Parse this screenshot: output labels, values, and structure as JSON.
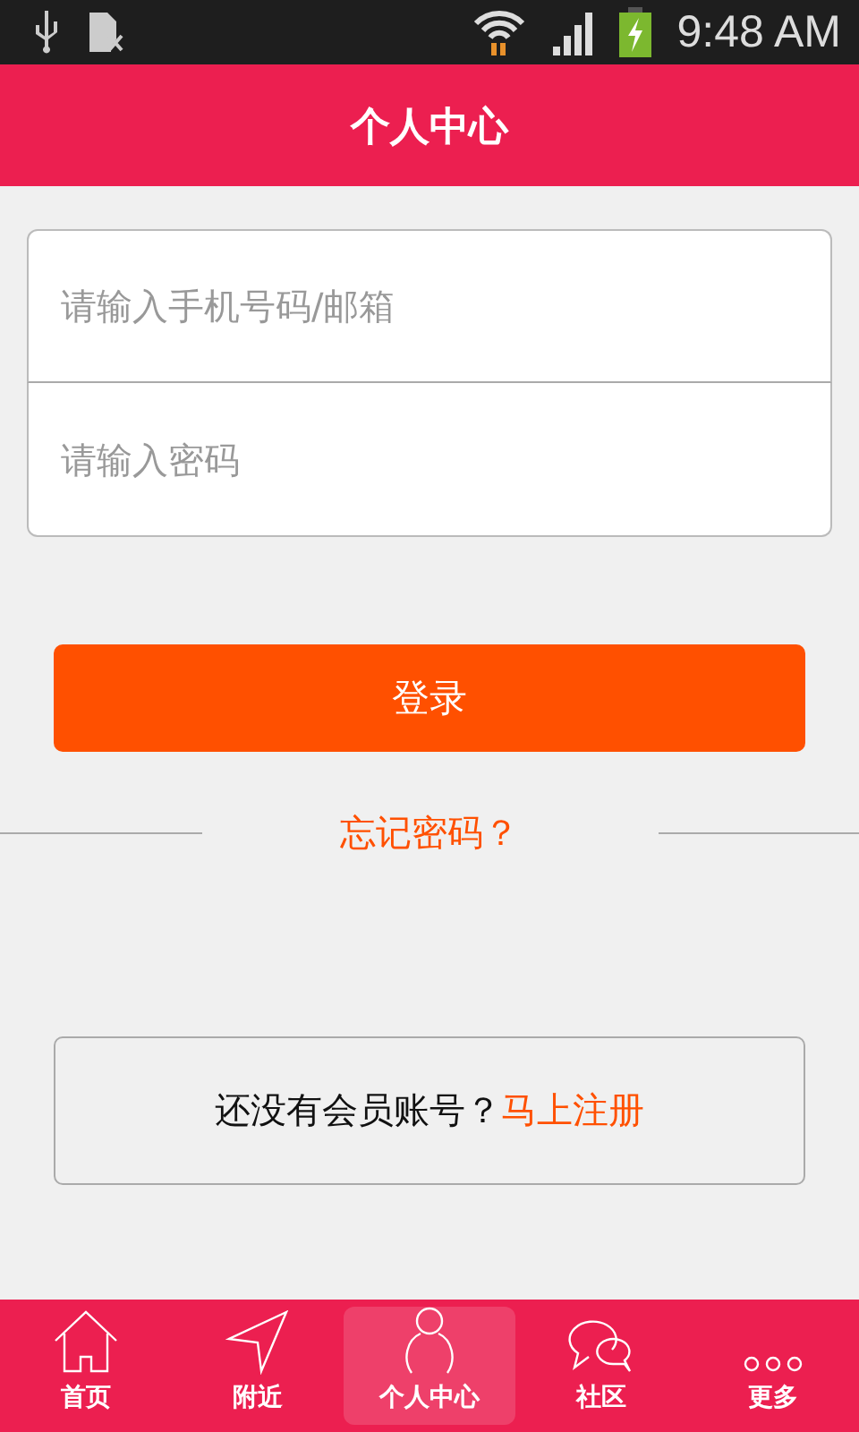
{
  "status_bar": {
    "time": "9:48 AM"
  },
  "header": {
    "title": "个人中心"
  },
  "form": {
    "fields": [
      {
        "placeholder": "请输入手机号码/邮箱"
      },
      {
        "placeholder": "请输入密码"
      }
    ]
  },
  "login_button": "登录",
  "forgot_link": "忘记密码？",
  "register": {
    "text": "还没有会员账号？",
    "link": "马上注册"
  },
  "tabs": [
    {
      "label": "首页",
      "selected": false
    },
    {
      "label": "附近",
      "selected": false
    },
    {
      "label": "个人中心",
      "selected": true
    },
    {
      "label": "社区",
      "selected": false
    },
    {
      "label": "更多",
      "selected": false
    }
  ]
}
